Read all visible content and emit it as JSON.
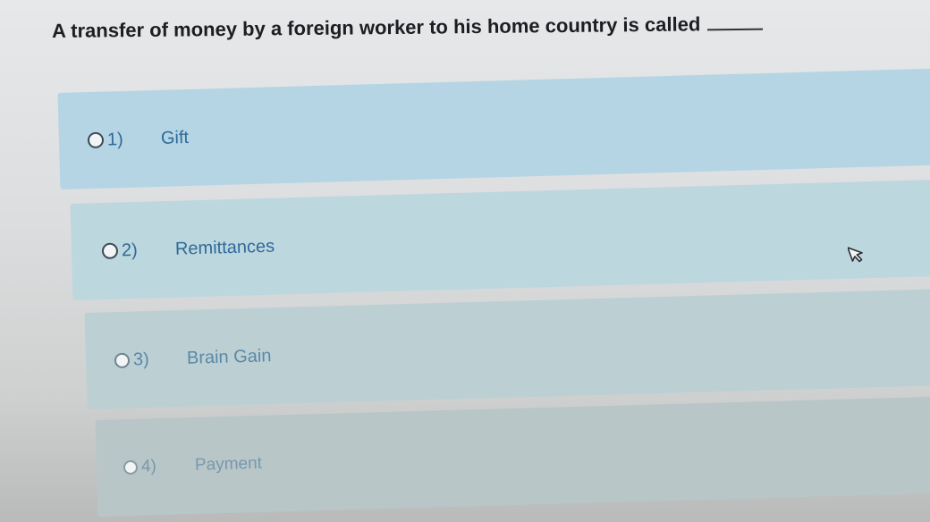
{
  "question": {
    "text": "A transfer of money by a foreign worker to his home country is called"
  },
  "options": [
    {
      "number": "1)",
      "label": "Gift"
    },
    {
      "number": "2)",
      "label": "Remittances"
    },
    {
      "number": "3)",
      "label": "Brain Gain"
    },
    {
      "number": "4)",
      "label": "Payment"
    }
  ],
  "cursor": {
    "icon": "arrow-pointer-icon"
  }
}
